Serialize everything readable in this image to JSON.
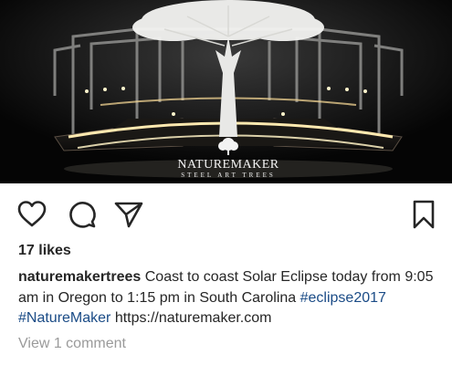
{
  "post": {
    "photo": {
      "description_alt": "",
      "watermark": {
        "brand": "NATUREMAKER",
        "tagline": "STEEL ART TREES"
      }
    },
    "actions": {
      "like_icon": "heart-icon",
      "comment_icon": "comment-icon",
      "share_icon": "share-icon",
      "save_icon": "bookmark-icon"
    },
    "likes_text": "17 likes",
    "caption": {
      "username": "naturemakertrees",
      "text": "Coast to coast Solar Eclipse today from 9:05 am in Oregon to 1:15 pm in South Carolina",
      "hashtag_1": "#eclipse2017",
      "hashtag_2": "#NatureMaker",
      "link": "https://naturemaker.com"
    },
    "view_comments": "View 1 comment"
  },
  "colors": {
    "text": "#262626",
    "hashtag": "#1a4b86",
    "muted": "#9a9a9a",
    "light": "#fff2c4"
  }
}
